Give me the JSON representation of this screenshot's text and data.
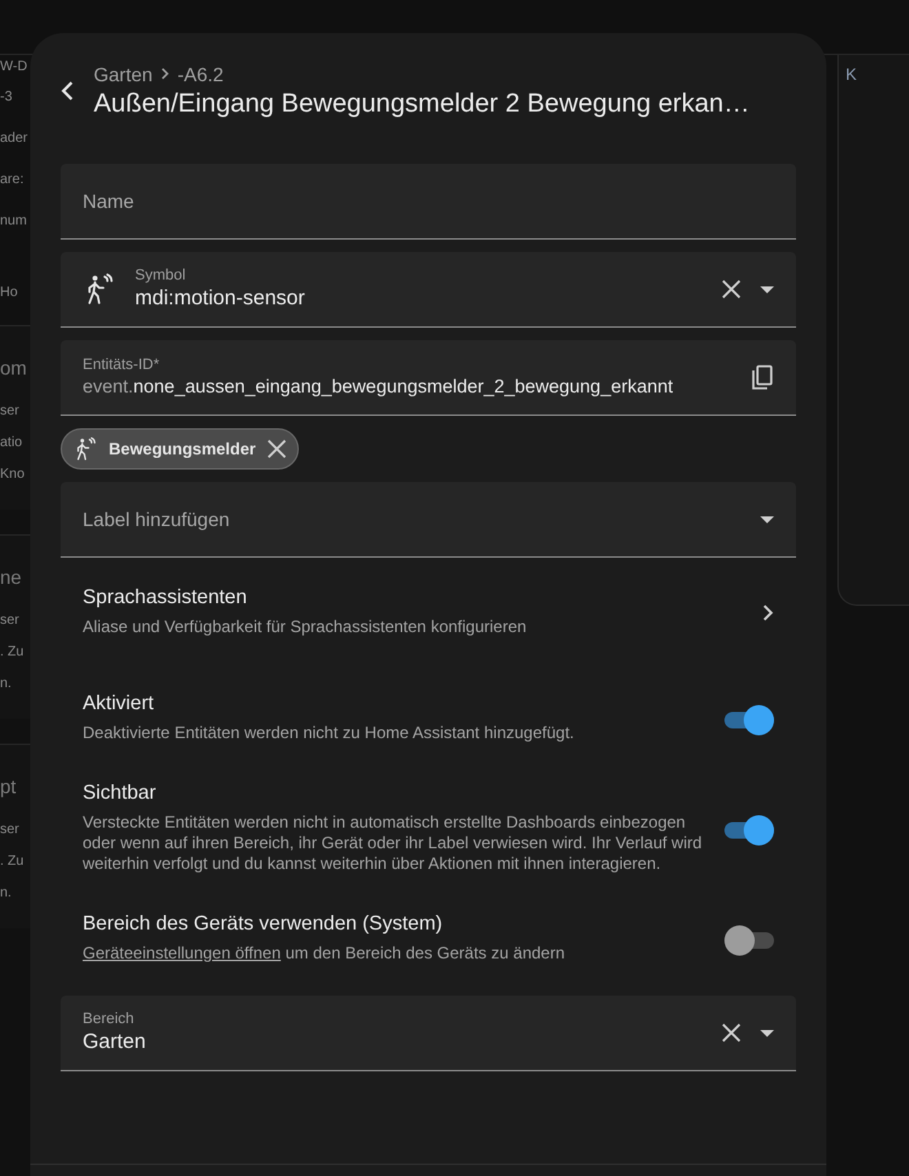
{
  "background": {
    "top_fragments": [
      "W-D",
      "-3",
      "ader",
      "are:",
      "num",
      "Ho"
    ],
    "cards": [
      {
        "heading": "om",
        "lines": [
          "ser",
          "atio",
          "Kno"
        ]
      },
      {
        "heading": "ne",
        "lines": [
          "ser",
          ". Zu",
          "n."
        ]
      },
      {
        "heading": "pt",
        "lines": [
          "ser",
          ". Zu",
          "n."
        ]
      }
    ],
    "right_fragment": "K"
  },
  "dialog": {
    "breadcrumb": [
      "Garten",
      "-A6.2"
    ],
    "title": "Außen/Eingang Bewegungsmelder 2 Bewegung erkan…",
    "fields": [
      {
        "kind": "text",
        "label": "Name"
      },
      {
        "kind": "icon_picker",
        "label": "Symbol",
        "value": "mdi:motion-sensor"
      },
      {
        "kind": "entity_id",
        "label": "Entitäts-ID*",
        "prefix": "event.",
        "value": "none_aussen_eingang_bewegungsmelder_2_bewegung_erkannt"
      }
    ],
    "chips": [
      {
        "label": "Bewegungsmelder"
      }
    ],
    "label_select": {
      "placeholder": "Label hinzufügen"
    },
    "settings": [
      {
        "kind": "link",
        "title": "Sprachassistenten",
        "description": "Aliase und Verfügbarkeit für Sprachassistenten konfigurieren"
      },
      {
        "kind": "toggle",
        "title": "Aktiviert",
        "description": "Deaktivierte Entitäten werden nicht zu Home Assistant hinzugefügt.",
        "on": true
      },
      {
        "kind": "toggle",
        "title": "Sichtbar",
        "description": "Versteckte Entitäten werden nicht in automatisch erstellte Dashboards einbezogen oder wenn auf ihren Bereich, ihr Gerät oder ihr Label verwiesen wird. Ihr Verlauf wird weiterhin verfolgt und du kannst weiterhin über Aktionen mit ihnen interagieren.",
        "on": true
      },
      {
        "kind": "toggle",
        "title": "Bereich des Geräts verwenden (System)",
        "link": "Geräteeinstellungen öffnen",
        "description": "um den Bereich des Geräts zu ändern",
        "on": false
      }
    ],
    "area_field": {
      "label": "Bereich",
      "value": "Garten"
    }
  }
}
